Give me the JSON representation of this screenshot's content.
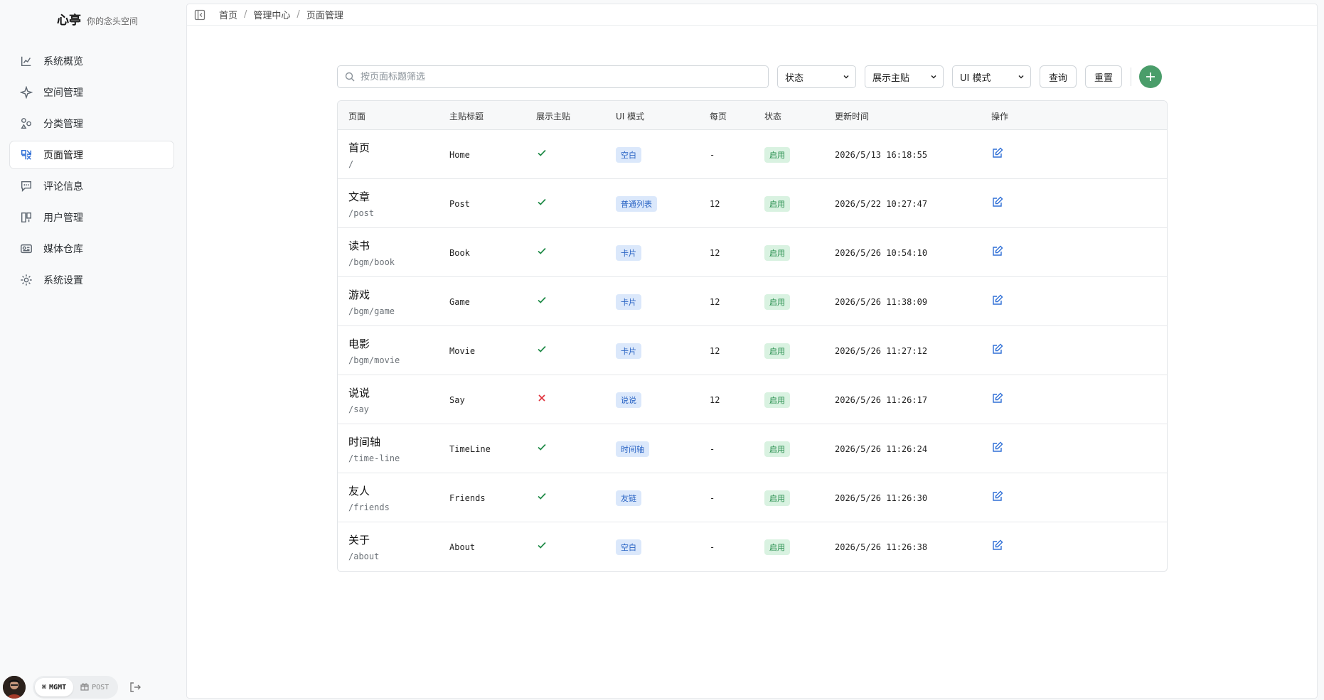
{
  "brand": {
    "name": "心亭",
    "subtitle": "你的念头空间"
  },
  "sidebar": {
    "items": [
      {
        "label": "系统概览",
        "icon": "chart-line-icon"
      },
      {
        "label": "空间管理",
        "icon": "sparkle-icon"
      },
      {
        "label": "分类管理",
        "icon": "shapes-icon"
      },
      {
        "label": "页面管理",
        "icon": "pages-icon",
        "active": true
      },
      {
        "label": "评论信息",
        "icon": "comment-icon"
      },
      {
        "label": "用户管理",
        "icon": "users-icon"
      },
      {
        "label": "媒体仓库",
        "icon": "media-icon"
      },
      {
        "label": "系统设置",
        "icon": "settings-gear-icon"
      }
    ],
    "mode_mgmt": "MGMT",
    "mode_post": "POST"
  },
  "breadcrumb": [
    "首页",
    "管理中心",
    "页面管理"
  ],
  "toolbar": {
    "search_placeholder": "按页面标题筛选",
    "status_select": "状态",
    "show_select": "展示主贴",
    "ui_select": "UI 模式",
    "query_label": "查询",
    "reset_label": "重置"
  },
  "table": {
    "headers": [
      "页面",
      "主贴标题",
      "展示主贴",
      "UI 模式",
      "每页",
      "状态",
      "更新时间",
      "操作"
    ],
    "rows": [
      {
        "title": "首页",
        "path": "/",
        "post": "Home",
        "show": true,
        "ui": "空白",
        "per_page": "-",
        "status": "启用",
        "updated": "2026/5/13 16:18:55"
      },
      {
        "title": "文章",
        "path": "/post",
        "post": "Post",
        "show": true,
        "ui": "普通列表",
        "per_page": "12",
        "status": "启用",
        "updated": "2026/5/22 10:27:47"
      },
      {
        "title": "读书",
        "path": "/bgm/book",
        "post": "Book",
        "show": true,
        "ui": "卡片",
        "per_page": "12",
        "status": "启用",
        "updated": "2026/5/26 10:54:10"
      },
      {
        "title": "游戏",
        "path": "/bgm/game",
        "post": "Game",
        "show": true,
        "ui": "卡片",
        "per_page": "12",
        "status": "启用",
        "updated": "2026/5/26 11:38:09"
      },
      {
        "title": "电影",
        "path": "/bgm/movie",
        "post": "Movie",
        "show": true,
        "ui": "卡片",
        "per_page": "12",
        "status": "启用",
        "updated": "2026/5/26 11:27:12"
      },
      {
        "title": "说说",
        "path": "/say",
        "post": "Say",
        "show": false,
        "ui": "说说",
        "per_page": "12",
        "status": "启用",
        "updated": "2026/5/26 11:26:17"
      },
      {
        "title": "时间轴",
        "path": "/time-line",
        "post": "TimeLine",
        "show": true,
        "ui": "时间轴",
        "per_page": "-",
        "status": "启用",
        "updated": "2026/5/26 11:26:24"
      },
      {
        "title": "友人",
        "path": "/friends",
        "post": "Friends",
        "show": true,
        "ui": "友链",
        "per_page": "-",
        "status": "启用",
        "updated": "2026/5/26 11:26:30"
      },
      {
        "title": "关于",
        "path": "/about",
        "post": "About",
        "show": true,
        "ui": "空白",
        "per_page": "-",
        "status": "启用",
        "updated": "2026/5/26 11:26:38"
      }
    ]
  },
  "colors": {
    "accent": "#2f6fd6",
    "success": "#1f8a47",
    "danger": "#e0323c",
    "add": "#4a9d6a"
  }
}
